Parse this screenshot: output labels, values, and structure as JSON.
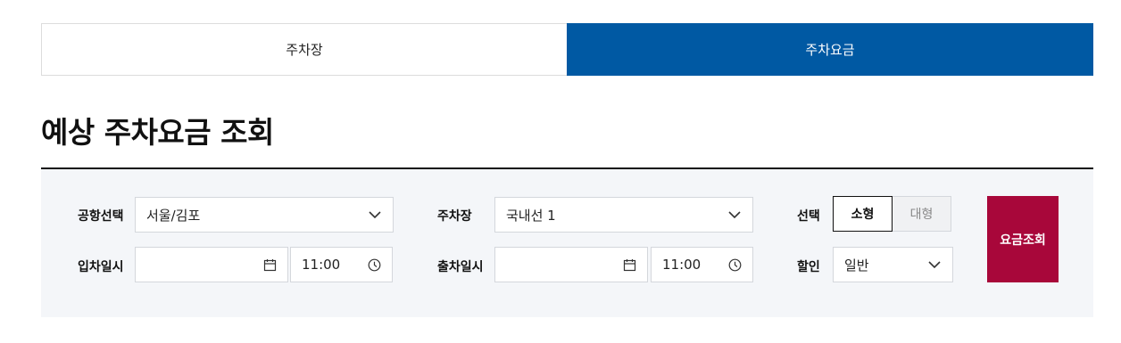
{
  "tabs": [
    {
      "label": "주차장"
    },
    {
      "label": "주차요금"
    }
  ],
  "page_title": "예상 주차요금 조회",
  "form": {
    "airport": {
      "label": "공항선택",
      "value": "서울/김포"
    },
    "parking_lot": {
      "label": "주차장",
      "value": "국내선 1"
    },
    "vehicle": {
      "label": "선택",
      "options": [
        "소형",
        "대형"
      ],
      "selected": "소형"
    },
    "entry": {
      "label": "입차일시",
      "date": "",
      "time": "11:00"
    },
    "exit": {
      "label": "출차일시",
      "date": "",
      "time": "11:00"
    },
    "discount": {
      "label": "할인",
      "value": "일반"
    },
    "submit_label": "요금조회"
  },
  "colors": {
    "accent": "#0059a3",
    "submit": "#a8073a",
    "panel_bg": "#f4f6f9"
  }
}
